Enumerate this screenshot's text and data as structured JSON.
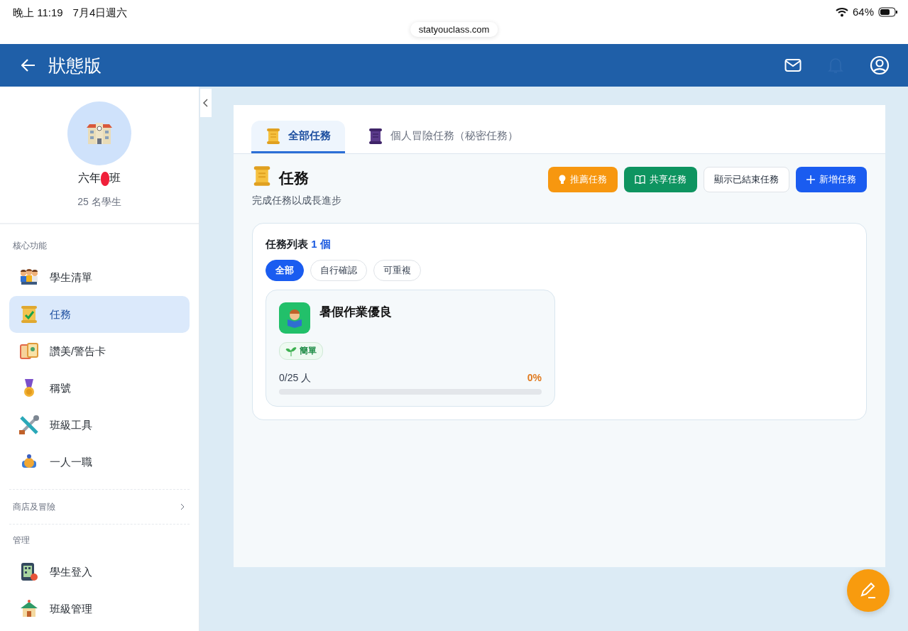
{
  "status_bar": {
    "time": "晚上 11:19",
    "date": "7月4日週六",
    "battery": "64%"
  },
  "url": "statyouclass.com",
  "header": {
    "title": "狀態版"
  },
  "sidebar": {
    "class_name_start": "六年",
    "class_name_end": "班",
    "student_count": "25 名學生",
    "sections": [
      {
        "kind": "group",
        "title": "核心功能",
        "items": [
          {
            "label": "學生清單",
            "selected": false
          },
          {
            "label": "任務",
            "selected": true
          },
          {
            "label": "讚美/警告卡",
            "selected": false
          },
          {
            "label": "稱號",
            "selected": false
          },
          {
            "label": "班級工具",
            "selected": false
          },
          {
            "label": "一人一職",
            "selected": false
          }
        ]
      },
      {
        "kind": "collapsible",
        "title": "商店及冒險",
        "expanded": false
      },
      {
        "kind": "group",
        "title": "管理",
        "items": [
          {
            "label": "學生登入",
            "selected": false
          },
          {
            "label": "班級管理",
            "selected": false
          }
        ]
      }
    ]
  },
  "tabs": [
    {
      "label": "全部任務",
      "selected": true
    },
    {
      "label": "個人冒險任務（秘密任務）",
      "selected": false
    }
  ],
  "page": {
    "title": "任務",
    "subtitle": "完成任務以成長進步"
  },
  "actions": [
    {
      "kind": "recommend",
      "label": "推薦任務"
    },
    {
      "kind": "share",
      "label": "共享任務"
    },
    {
      "kind": "show-ended",
      "label": "顯示已結束任務"
    },
    {
      "kind": "add",
      "label": "新增任務"
    }
  ],
  "task_list": {
    "title": "任務列表",
    "count": "1 個",
    "filters": [
      {
        "label": "全部",
        "selected": true
      },
      {
        "label": "自行確認",
        "selected": false
      },
      {
        "label": "可重複",
        "selected": false
      }
    ],
    "tasks": [
      {
        "title": "暑假作業優良",
        "difficulty": "簡單",
        "progress_text": "0/25 人",
        "percent": "0%",
        "level": 0
      }
    ]
  }
}
